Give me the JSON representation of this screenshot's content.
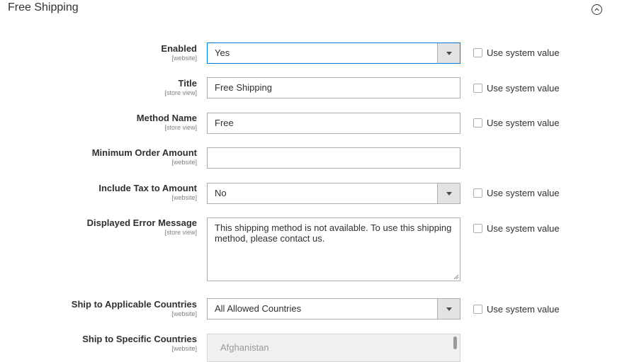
{
  "section": {
    "title": "Free Shipping",
    "collapse_icon": "chevron-up-circle-icon"
  },
  "fields": [
    {
      "label": "Enabled",
      "scope": "[website]",
      "type": "select",
      "value": "Yes",
      "use_system_value": "Use system value"
    },
    {
      "label": "Title",
      "scope": "[store view]",
      "type": "text",
      "value": "Free Shipping",
      "use_system_value": "Use system value"
    },
    {
      "label": "Method Name",
      "scope": "[store view]",
      "type": "text",
      "value": "Free",
      "use_system_value": "Use system value"
    },
    {
      "label": "Minimum Order Amount",
      "scope": "[website]",
      "type": "text",
      "value": ""
    },
    {
      "label": "Include Tax to Amount",
      "scope": "[website]",
      "type": "select",
      "value": "No",
      "use_system_value": "Use system value"
    },
    {
      "label": "Displayed Error Message",
      "scope": "[store view]",
      "type": "textarea",
      "value": "This shipping method is not available. To use this shipping method, please contact us.",
      "use_system_value": "Use system value"
    },
    {
      "label": "Ship to Applicable Countries",
      "scope": "[website]",
      "type": "select",
      "value": "All Allowed Countries",
      "use_system_value": "Use system value"
    },
    {
      "label": "Ship to Specific Countries",
      "scope": "[website]",
      "type": "multiselect",
      "value": "Afghanistan"
    }
  ]
}
